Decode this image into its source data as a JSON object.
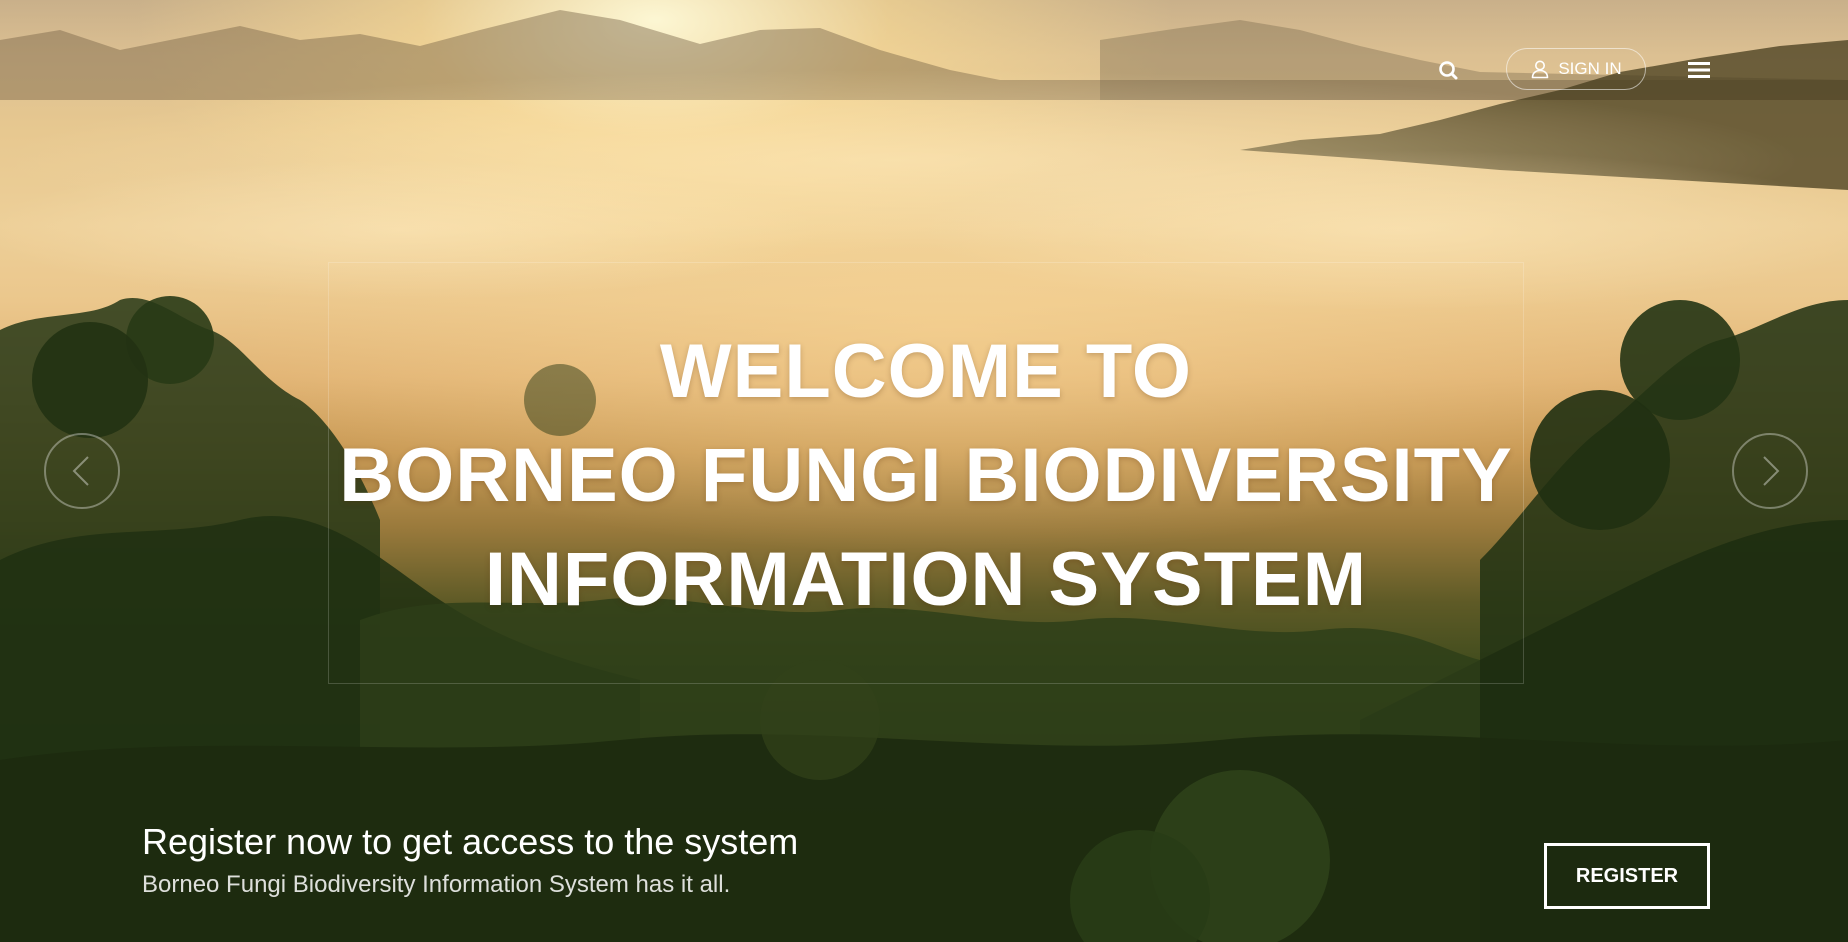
{
  "header": {
    "search_icon": "search-icon",
    "signin_icon": "user-icon",
    "signin_label": "SIGN IN",
    "menu_icon": "hamburger-menu-icon"
  },
  "hero": {
    "headline_line1": "WELCOME TO",
    "headline_line2": "BORNEO FUNGI BIODIVERSITY",
    "headline_line3": "INFORMATION SYSTEM",
    "prev_icon": "chevron-left-icon",
    "next_icon": "chevron-right-icon"
  },
  "cta": {
    "title": "Register now to get access to the system",
    "subtitle": "Borneo Fungi Biodiversity Information System has it all.",
    "register_label": "REGISTER"
  },
  "colors": {
    "text": "#ffffff",
    "sky": "#ebc78c",
    "forest": "#2d3c17"
  }
}
